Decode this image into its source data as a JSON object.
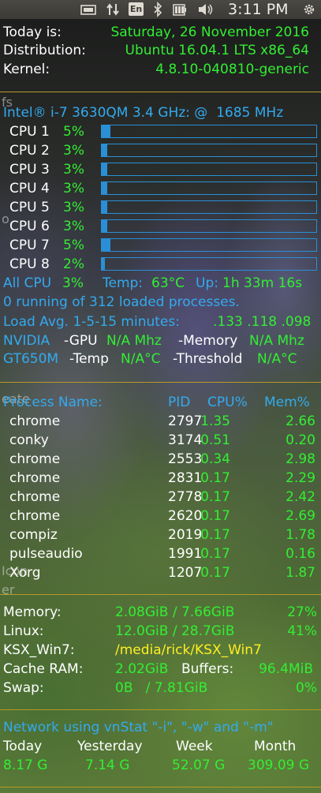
{
  "topbar": {
    "kbd_label": "En",
    "clock": "3:11 PM",
    "icons": [
      "screen-icon",
      "network-arrows-icon",
      "keyboard-layout-icon",
      "bluetooth-icon",
      "battery-icon",
      "volume-icon",
      "gear-icon"
    ]
  },
  "system": {
    "today_label": "Today is:",
    "today_value": "Saturday, 26 November 2016",
    "distro_label": "Distribution:",
    "distro_value": "Ubuntu 16.04.1 LTS x86_64",
    "kernel_label": "Kernel:",
    "kernel_value": "4.8.10-040810-generic"
  },
  "cpu": {
    "model": "Intel® i-7 3630QM 3.4 GHz: @  1685 MHz",
    "cores": [
      {
        "label": "CPU 1",
        "pct": "5%",
        "value": 5
      },
      {
        "label": "CPU 2",
        "pct": "3%",
        "value": 3
      },
      {
        "label": "CPU 3",
        "pct": "3%",
        "value": 3
      },
      {
        "label": "CPU 4",
        "pct": "3%",
        "value": 3
      },
      {
        "label": "CPU 5",
        "pct": "3%",
        "value": 3
      },
      {
        "label": "CPU 6",
        "pct": "3%",
        "value": 3
      },
      {
        "label": "CPU 7",
        "pct": "5%",
        "value": 5
      },
      {
        "label": "CPU 8",
        "pct": "2%",
        "value": 2
      }
    ],
    "all_label": "All CPU",
    "all_value": "3%",
    "temp_label": "Temp:",
    "temp_value": "63°C",
    "uptime_label": "Up:",
    "uptime_value": "1h 33m 16s",
    "processes_line": "0 running of 312 loaded processes.",
    "load_label": "Load Avg. 1-5-15 minutes:",
    "load_value": ".133 .118 .098"
  },
  "gpu": {
    "name1": "NVIDIA",
    "gpu_label": "-GPU",
    "gpu_value": "N/A Mhz",
    "mem_label": "-Memory",
    "mem_value": "N/A Mhz",
    "name2": "GT650M",
    "temp_label": "-Temp",
    "temp_value": "N/A°C",
    "thr_label": "-Threshold",
    "thr_value": "N/A°C"
  },
  "processes": {
    "headers": [
      "Process Name:",
      "PID",
      "CPU%",
      "Mem%"
    ],
    "rows": [
      {
        "name": "chrome",
        "pid": "2797",
        "cpu": "1.35",
        "mem": "2.66"
      },
      {
        "name": "conky",
        "pid": "3174",
        "cpu": "0.51",
        "mem": "0.20"
      },
      {
        "name": "chrome",
        "pid": "2553",
        "cpu": "0.34",
        "mem": "2.98"
      },
      {
        "name": "chrome",
        "pid": "2831",
        "cpu": "0.17",
        "mem": "2.29"
      },
      {
        "name": "chrome",
        "pid": "2778",
        "cpu": "0.17",
        "mem": "2.42"
      },
      {
        "name": "chrome",
        "pid": "2620",
        "cpu": "0.17",
        "mem": "2.69"
      },
      {
        "name": "compiz",
        "pid": "2019",
        "cpu": "0.17",
        "mem": "1.78"
      },
      {
        "name": "pulseaudio",
        "pid": "1991",
        "cpu": "0.17",
        "mem": "0.16"
      },
      {
        "name": "Xorg",
        "pid": "1207",
        "cpu": "0.17",
        "mem": "1.87"
      }
    ]
  },
  "memory": {
    "mem_label": "Memory:",
    "mem_value": "2.08GiB / 7.66GiB",
    "mem_pct": "27%",
    "linux_label": "Linux:",
    "linux_value": "12.0GiB / 28.7GiB",
    "linux_pct": "41%",
    "ksx_label": "KSX_Win7:",
    "ksx_value": "/media/rick/KSX_Win7",
    "cache_label": "Cache RAM:",
    "cache_value": "2.02GiB",
    "buffers_label": "Buffers:",
    "buffers_value": "96.4MiB",
    "swap_label": "Swap:",
    "swap_value": "0B   / 7.81GiB",
    "swap_pct": "0%"
  },
  "network": {
    "title": "Network using vnStat \"-i\", \"-w\" and \"-m\"",
    "headers": [
      "Today",
      "Yesterday",
      "Week",
      "Month"
    ],
    "values": [
      "8.17 G",
      "7.14 G",
      "52.07 G",
      "309.09 G"
    ]
  },
  "colors": {
    "label": "#ffffff",
    "value_green": "#33ee33",
    "accent_blue": "#33aaee",
    "path_yellow": "#ffee22",
    "rule_gold": "#b59a25"
  }
}
